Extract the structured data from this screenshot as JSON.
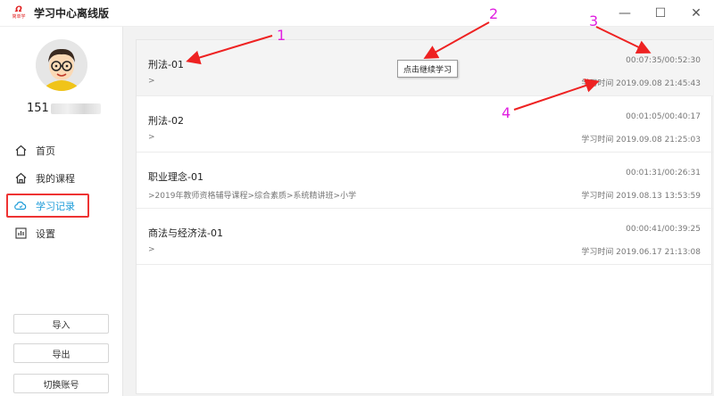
{
  "app": {
    "logo_mark": "Ω",
    "logo_sub": "简单学",
    "title": "学习中心离线版"
  },
  "window": {
    "minimize": "—",
    "maximize": "☐",
    "close": "✕"
  },
  "user": {
    "id_prefix": "151"
  },
  "nav": [
    {
      "label": "首页",
      "icon": "home-icon"
    },
    {
      "label": "我的课程",
      "icon": "home-outline-icon"
    },
    {
      "label": "学习记录",
      "icon": "cloud-icon",
      "active": true
    },
    {
      "label": "设置",
      "icon": "chart-icon"
    }
  ],
  "buttons": {
    "import": "导入",
    "export": "导出",
    "switch": "切换账号"
  },
  "records": [
    {
      "name": "刑法-01",
      "path": ">",
      "progress": "00:07:35/00:52:30",
      "time": "学习时间 2019.09.08 21:45:43"
    },
    {
      "name": "刑法-02",
      "path": ">",
      "progress": "00:01:05/00:40:17",
      "time": "学习时间 2019.09.08 21:25:03"
    },
    {
      "name": "职业理念-01",
      "path": ">2019年教师资格辅导课程>综合素质>系统精讲班>小学",
      "progress": "00:01:31/00:26:31",
      "time": "学习时间 2019.08.13 13:53:59"
    },
    {
      "name": "商法与经济法-01",
      "path": ">",
      "progress": "00:00:41/00:39:25",
      "time": "学习时间 2019.06.17 21:13:08"
    }
  ],
  "tooltip": "点击继续学习",
  "annotations": [
    "1",
    "2",
    "3",
    "4"
  ],
  "colors": {
    "accent": "#1c9bd8",
    "highlight": "#e33333",
    "annotation": "#e020e0"
  }
}
